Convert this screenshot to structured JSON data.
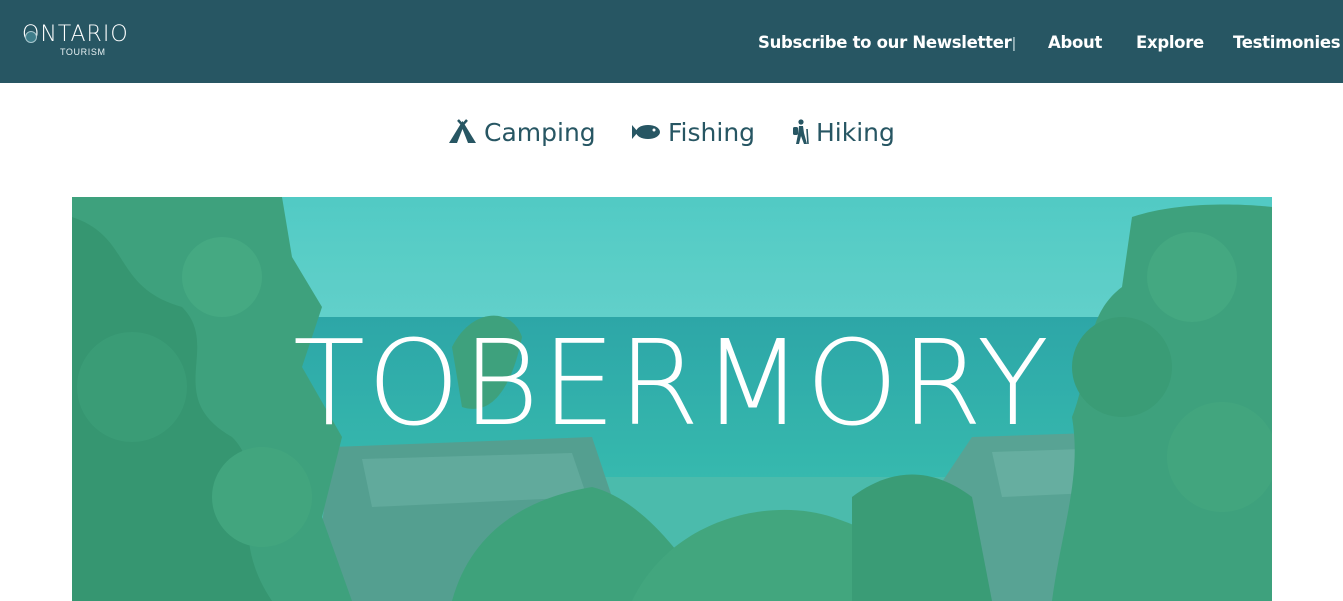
{
  "header": {
    "logo": {
      "wordmark": "ONTARIO",
      "subtitle": "TOURISM"
    },
    "nav": {
      "newsletter": "Subscribe to our Newsletter",
      "separator": "|",
      "about": "About",
      "explore": "Explore",
      "testimonies": "Testimonies"
    }
  },
  "activities": [
    {
      "label": "Camping",
      "icon": "tent-icon"
    },
    {
      "label": "Fishing",
      "icon": "fish-icon"
    },
    {
      "label": "Hiking",
      "icon": "hiker-icon"
    }
  ],
  "hero": {
    "title": "TOBERMORY",
    "overlay_color": "#3fb5a8"
  },
  "colors": {
    "brand": "#275663",
    "header_text": "#ffffff"
  }
}
